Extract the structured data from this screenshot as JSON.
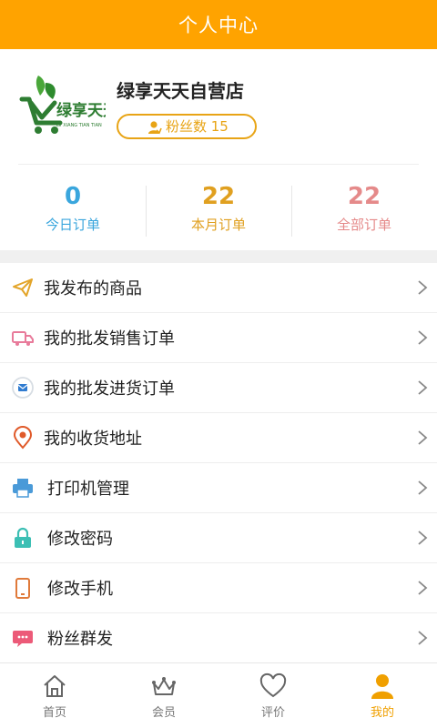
{
  "header": {
    "title": "个人中心"
  },
  "profile": {
    "shop_name": "绿享天天自营店",
    "fans_label": "粉丝数 15",
    "logo_text": "绿享天天",
    "logo_subtext": "LV XIANG TIAN TIAN"
  },
  "stats": [
    {
      "value": "0",
      "label": "今日订单",
      "color": "#3AA6DD"
    },
    {
      "value": "22",
      "label": "本月订单",
      "color": "#E0A020"
    },
    {
      "value": "22",
      "label": "全部订单",
      "color": "#E58A8A"
    }
  ],
  "menu": [
    {
      "label": "我发布的商品",
      "icon": "paper-plane-icon"
    },
    {
      "label": "我的批发销售订单",
      "icon": "truck-icon"
    },
    {
      "label": "我的批发进货订单",
      "icon": "mail-icon"
    },
    {
      "label": "我的收货地址",
      "icon": "location-pin-icon"
    },
    {
      "label": "打印机管理",
      "icon": "printer-icon"
    },
    {
      "label": "修改密码",
      "icon": "lock-icon"
    },
    {
      "label": "修改手机",
      "icon": "phone-icon"
    },
    {
      "label": "粉丝群发",
      "icon": "chat-bubble-icon"
    }
  ],
  "nav": [
    {
      "label": "首页",
      "icon": "home-icon"
    },
    {
      "label": "会员",
      "icon": "crown-icon"
    },
    {
      "label": "评价",
      "icon": "heart-icon"
    },
    {
      "label": "我的",
      "icon": "user-icon",
      "active": true
    }
  ],
  "colors": {
    "accent": "#FFA300",
    "nav_active": "#F0A000"
  }
}
